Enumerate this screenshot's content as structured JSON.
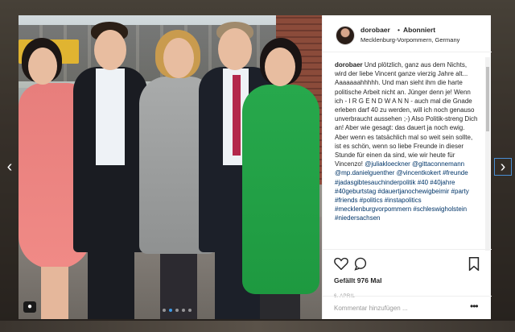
{
  "navigation": {
    "prev_icon": "chevron-left-icon",
    "next_icon": "chevron-right-icon",
    "prev_glyph": "‹",
    "next_glyph": "›"
  },
  "post": {
    "username": "dorobaer",
    "follow_status": "Abonniert",
    "follow_separator": "•",
    "location": "Mecklenburg-Vorpommern, Germany",
    "caption_text": "Und plötzlich, ganz aus dem Nichts, wird der liebe Vincent ganze vierzig Jahre alt... Aaaaaaahhhhh. Und man sieht ihm die harte politische Arbeit nicht an. Jünger denn je! Wenn ich - I R G E N D W A N N - auch mal die Gnade erleben darf 40 zu werden, will ich noch genauso unverbraucht aussehen ;-) Also Politik-streng Dich an! Aber wie gesagt: das dauert ja noch ewig. Aber wenn es tatsächlich mal so weit sein sollte, ist es schön, wenn so liebe Freunde in dieser Stunde für einen da sind, wie wir heute für Vincenzo!",
    "caption_tags": "@juliakloeckner @gittaconnemann @mp.danielguenther @vincentkokert #freunde #jadasgibtesauchinderpolitik #40 #40jahre #40geburtstag #dauertjanochewigbeimir #party #friends #politics #instapolitics #mecklenburgvorpommern #schleswigholstein #niedersachsen",
    "likes_text": "Gefällt 976 Mal",
    "date_text": "6. APRIL",
    "comment_placeholder": "Kommentar hinzufügen ...",
    "more_label": "•••"
  },
  "photo": {
    "carousel_total": 5,
    "carousel_active_index": 1,
    "user_tag_icon": "person-tag-icon",
    "user_tag_glyph": "👤"
  },
  "icons": {
    "like": "heart-icon",
    "comment": "comment-icon",
    "save": "bookmark-icon"
  }
}
